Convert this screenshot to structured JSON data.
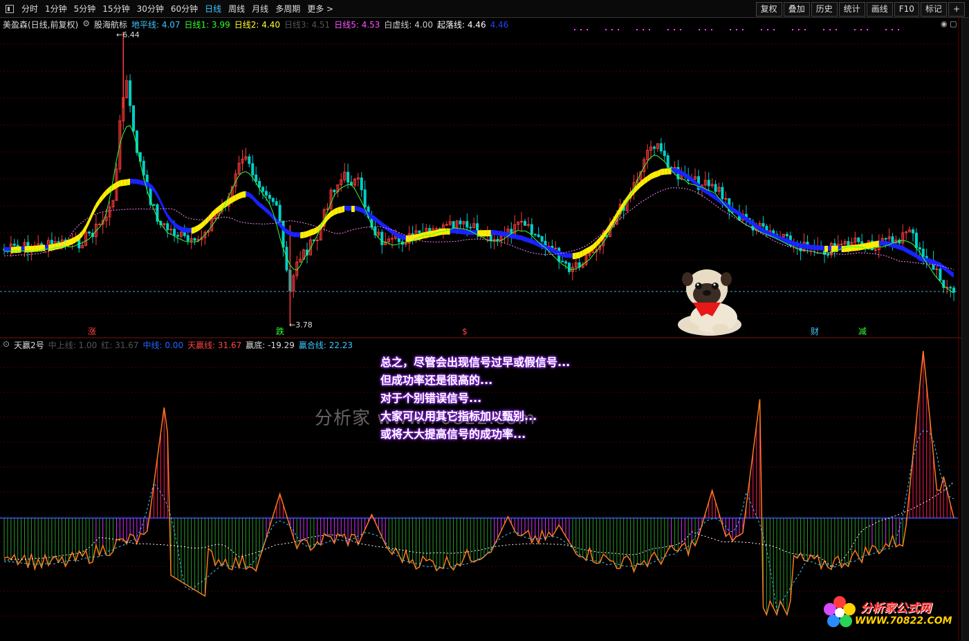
{
  "toolbar": {
    "periods": [
      "分时",
      "1分钟",
      "5分钟",
      "15分钟",
      "30分钟",
      "60分钟",
      "日线",
      "周线",
      "月线",
      "多周期",
      "更多"
    ],
    "active_period": "日线",
    "more_icon": "chevron-right-icon",
    "right_buttons": [
      "复权",
      "叠加",
      "历史",
      "统计",
      "画线",
      "F10",
      "标记",
      "+"
    ]
  },
  "main_legend": {
    "stock": "美盈森(日线,前复权)",
    "indicator_name": "股海航标",
    "items": [
      {
        "label": "地平线: 4.07",
        "color": "#3fc8ff"
      },
      {
        "label": "日线1: 3.99",
        "color": "#33ff33"
      },
      {
        "label": "日线2: 4.40",
        "color": "#ffff33"
      },
      {
        "label": "日线3: 4.51",
        "color": "#555555"
      },
      {
        "label": "日线5: 4.53",
        "color": "#ff55ff"
      },
      {
        "label": "白虚线: 4.00",
        "color": "#cccccc"
      },
      {
        "label": "起落线: 4.46",
        "color": "#ffffff"
      },
      {
        "label": "4.46",
        "color": "#2244ff"
      }
    ],
    "high_label": "6.44",
    "low_label": "3.78",
    "signals": [
      {
        "text": "涨",
        "color": "#ff4444"
      },
      {
        "text": "跌",
        "color": "#33ff33"
      },
      {
        "text": "$",
        "color": "#ff4444"
      },
      {
        "text": "财",
        "color": "#3fc8ff"
      },
      {
        "text": "减",
        "color": "#33ff33"
      }
    ]
  },
  "sub_legend": {
    "indicator_name": "天赢2号",
    "items": [
      {
        "label": "中上线: 1.00",
        "color": "#555555"
      },
      {
        "label": "红: 31.67",
        "color": "#555555"
      },
      {
        "label": "中线: 0.00",
        "color": "#2266ff"
      },
      {
        "label": "天赢线: 31.67",
        "color": "#ff4444"
      },
      {
        "label": "赢底: -19.29",
        "color": "#dddddd"
      },
      {
        "label": "赢合线: 22.23",
        "color": "#3fc8ff"
      }
    ]
  },
  "annotation": {
    "lines": [
      "总之，尽管会出现信号过早或假信号...",
      "但成功率还是很高的...",
      "对于个别错误信号...",
      "大家可以用其它指标加以甄别...",
      "或将大大提高信号的成功率..."
    ]
  },
  "watermark": "分析家 www.70822.com",
  "brand": {
    "title": "分析家公式网",
    "url": "WWW.70822.COM"
  }
}
